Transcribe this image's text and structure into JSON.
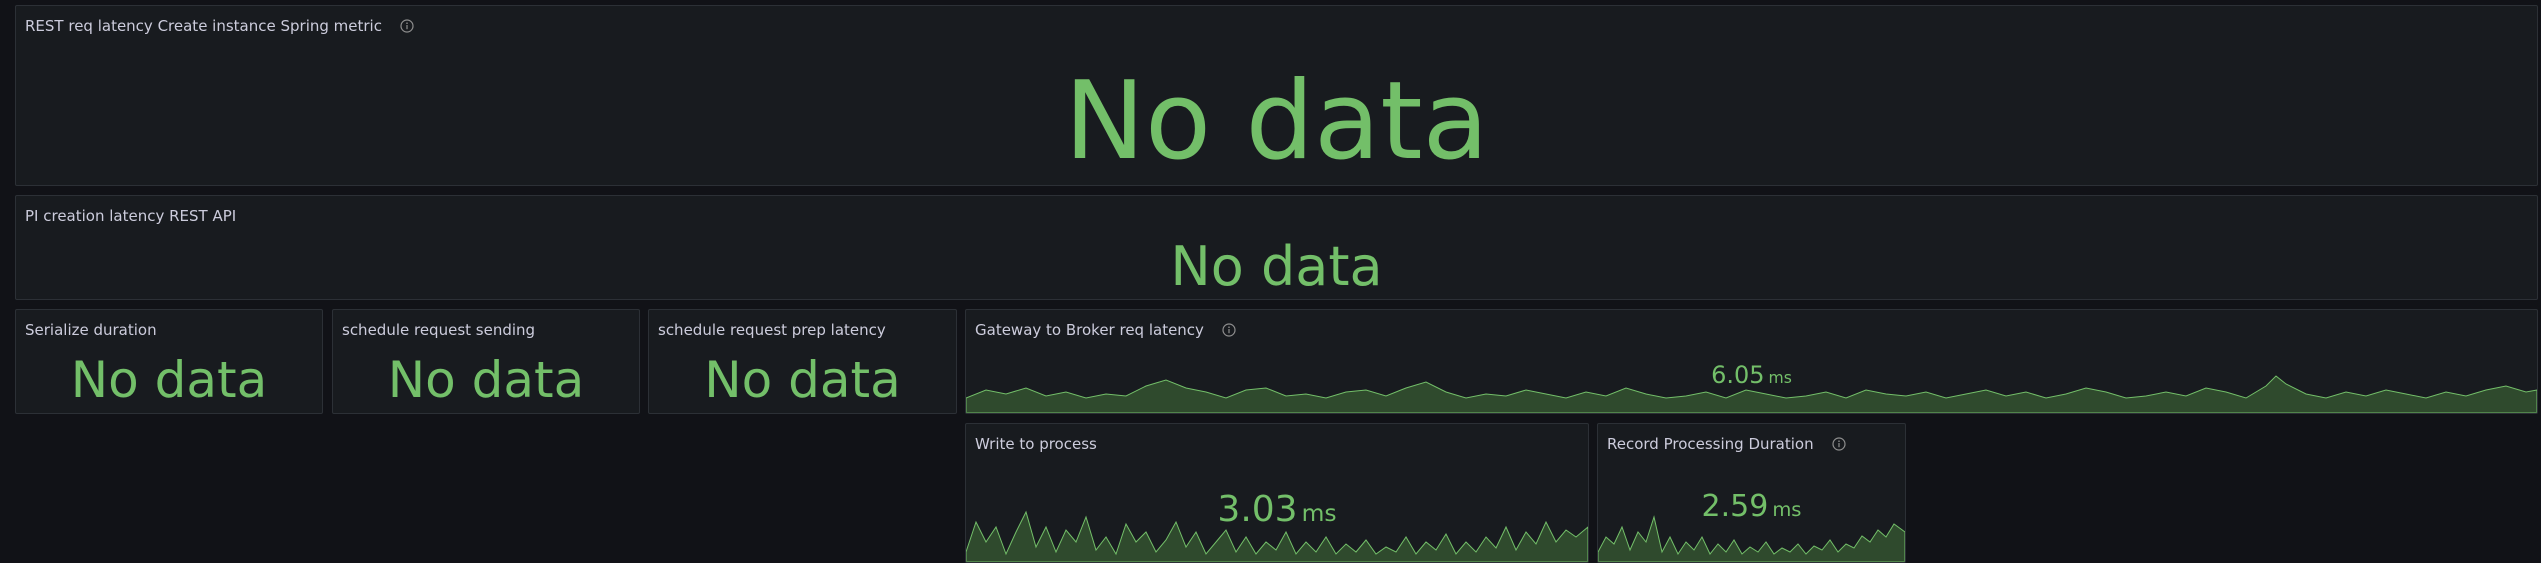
{
  "colors": {
    "background": "#111217",
    "panel": "#181b1f",
    "panel_border": "#2c3036",
    "title_text": "#ccccdc",
    "value_green": "#73bf69",
    "spark_fill": "#2f4a2d"
  },
  "panels": {
    "rest_req_latency": {
      "title": "REST req latency Create instance Spring metric",
      "has_info_icon": true,
      "value": "No data"
    },
    "pi_creation_latency": {
      "title": "PI creation latency REST API",
      "value": "No data"
    },
    "serialize_duration": {
      "title": "Serialize duration",
      "value": "No data"
    },
    "schedule_request_sending": {
      "title": "schedule request sending",
      "value": "No data"
    },
    "schedule_request_prep_latency": {
      "title": "schedule request prep latency",
      "value": "No data"
    },
    "gateway_to_broker": {
      "title": "Gateway to Broker req latency",
      "has_info_icon": true,
      "value": "6.05",
      "unit": "ms"
    },
    "write_to_process": {
      "title": "Write to process",
      "value": "3.03",
      "unit": "ms"
    },
    "record_processing_duration": {
      "title": "Record Processing Duration",
      "has_info_icon": true,
      "value": "2.59",
      "unit": "ms"
    }
  }
}
